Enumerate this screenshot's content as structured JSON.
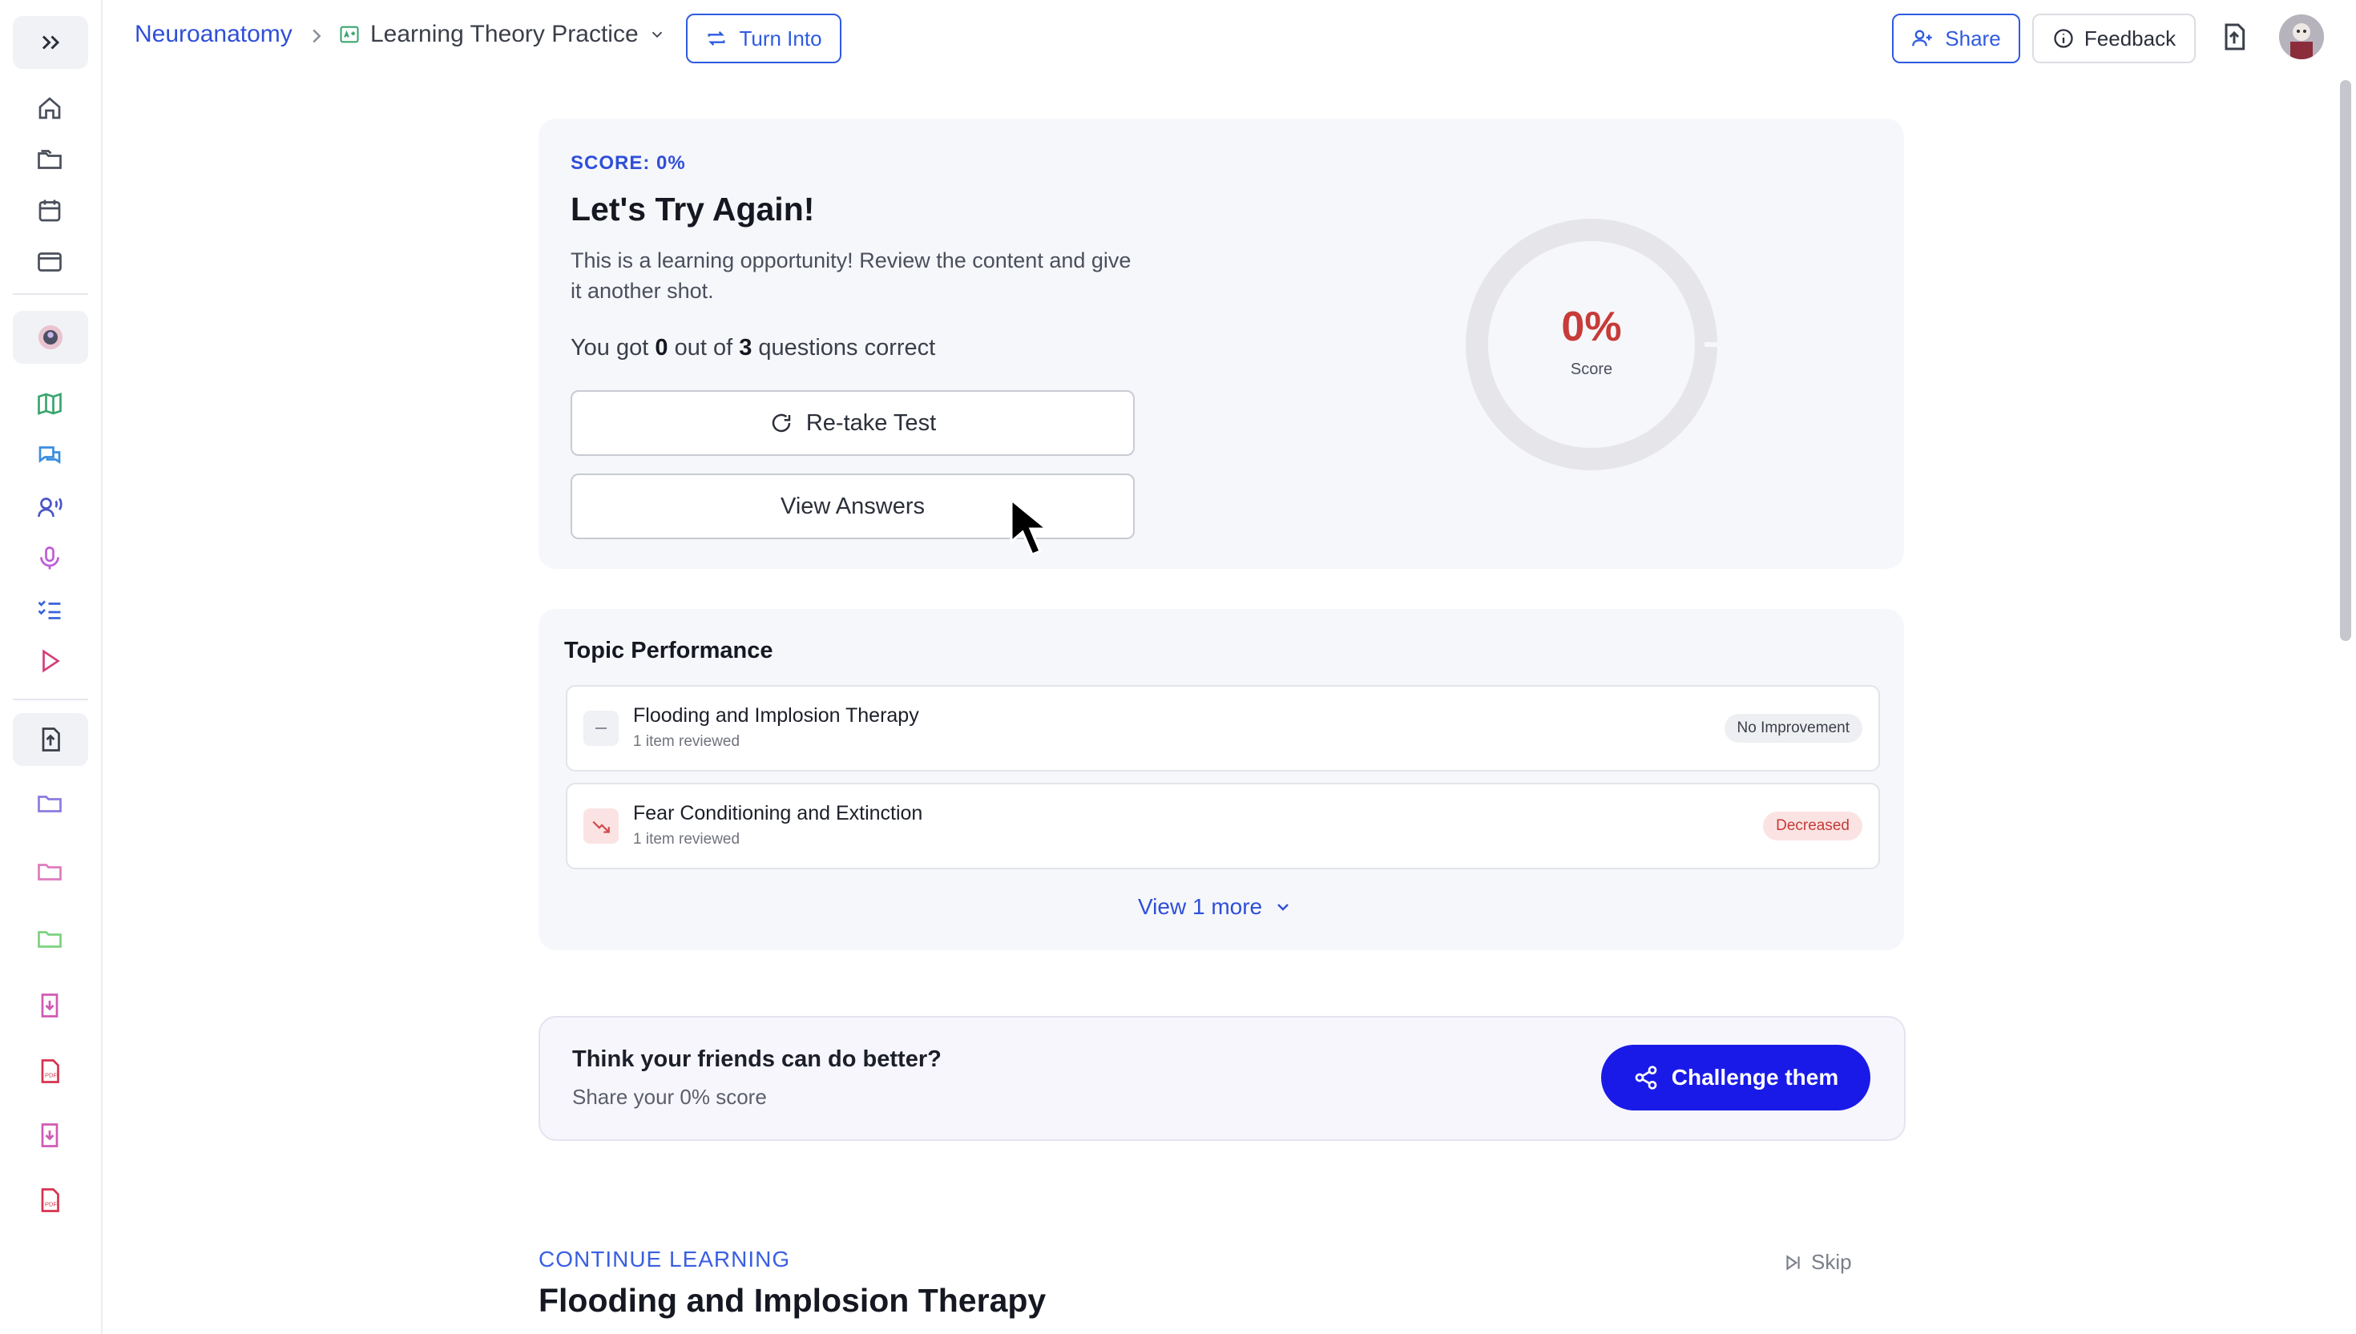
{
  "breadcrumb": {
    "root": "Neuroanatomy",
    "file": "Learning Theory Practice",
    "turn_into": "Turn Into"
  },
  "topbar": {
    "share": "Share",
    "feedback": "Feedback"
  },
  "sidebar": {
    "icons": [
      "expand-icon",
      "home-icon",
      "folders-icon",
      "calendar-icon",
      "browser-icon",
      "avatar-logo",
      "map-icon",
      "chat-icon",
      "voice-icon",
      "mic-icon",
      "checklist-icon",
      "play-icon",
      "upload-file-icon",
      "folder-purple-icon",
      "folder-pink-icon",
      "folder-green-icon",
      "download-doc-icon",
      "pdf-icon",
      "download-doc-icon",
      "pdf-icon"
    ]
  },
  "result": {
    "score_label": "SCORE: 0%",
    "heading": "Let's Try Again!",
    "message": "This is a learning opportunity! Review the content and give it another shot.",
    "summary_prefix": "You got ",
    "correct": "0",
    "summary_mid": " out of ",
    "total": "3",
    "summary_suffix": " questions correct",
    "retake": "Re-take Test",
    "view_answers": "View Answers",
    "gauge_value": "0%",
    "gauge_label": "Score",
    "score_fraction": 0
  },
  "topic_performance": {
    "title": "Topic Performance",
    "rows": [
      {
        "title": "Flooding and Implosion Therapy",
        "sub": "1 item reviewed",
        "status": "No Improvement"
      },
      {
        "title": "Fear Conditioning and Extinction",
        "sub": "1 item reviewed",
        "status": "Decreased"
      }
    ],
    "view_more": "View 1 more"
  },
  "challenge": {
    "title": "Think your friends can do better?",
    "sub": "Share your 0% score",
    "button": "Challenge them"
  },
  "continue": {
    "label": "CONTINUE LEARNING",
    "skip": "Skip",
    "title": "Flooding and Implosion Therapy"
  },
  "colors": {
    "brand_blue": "#2f4fd8",
    "challenge_button": "#1a1ae8",
    "score_red": "#c73b38",
    "decreased_bg": "#fbe3e3"
  }
}
